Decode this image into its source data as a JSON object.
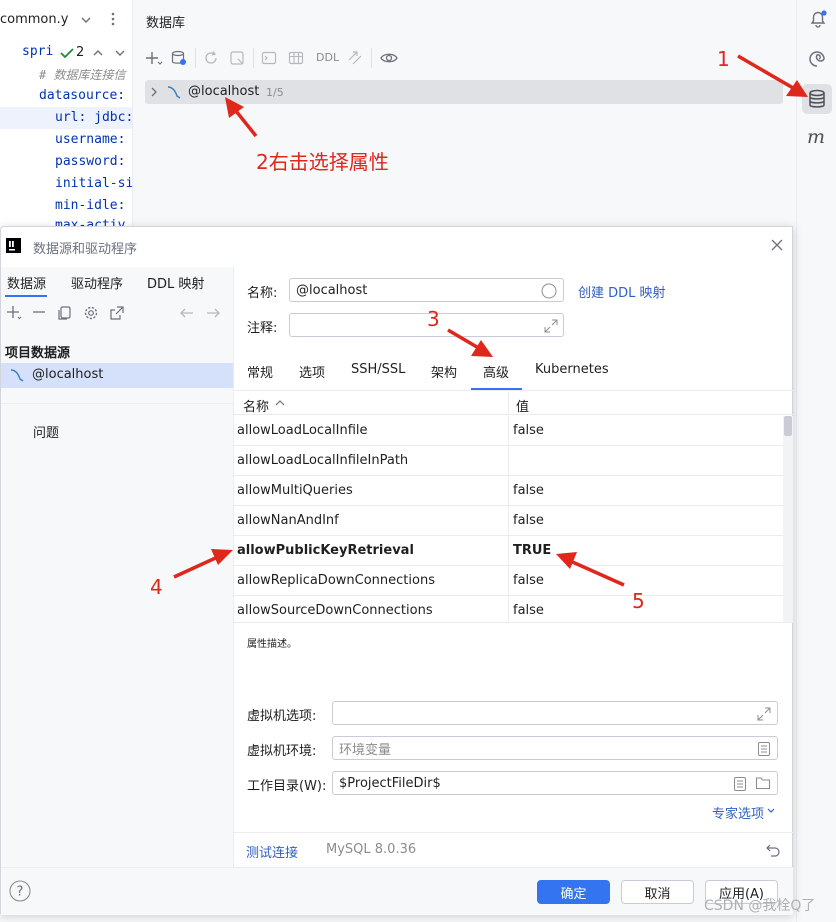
{
  "editor": {
    "tab_name": "common.y",
    "code_lines": [
      {
        "text": "spri",
        "color": "#0033b3"
      },
      {
        "text": "# 数据库连接信",
        "color": "#8c8c8c"
      },
      {
        "text": "datasource:",
        "color": "#0033b3"
      },
      {
        "text": "url: jdbc:",
        "color": "#0033b3"
      },
      {
        "text": "username:",
        "color": "#0033b3"
      },
      {
        "text": "password:",
        "color": "#0033b3"
      },
      {
        "text": "initial-si",
        "color": "#0033b3"
      },
      {
        "text": "min-idle:",
        "color": "#0033b3"
      },
      {
        "text": "max-activ",
        "color": "#0033b3"
      }
    ],
    "inspection_count": "2"
  },
  "db_pane": {
    "title": "数据库",
    "ddl_label": "DDL",
    "tree_item": "@localhost",
    "tree_count": "1/5"
  },
  "dialog": {
    "title": "数据源和驱动程序",
    "left_tabs": [
      "数据源",
      "驱动程序",
      "DDL 映射"
    ],
    "section_title": "项目数据源",
    "datasource_item": "@localhost",
    "problems_label": "问题",
    "name_label": "名称:",
    "name_value": "@localhost",
    "create_ddl_link": "创建 DDL 映射",
    "comment_label": "注释:",
    "tabs": [
      "常规",
      "选项",
      "SSH/SSL",
      "架构",
      "高级",
      "Kubernetes"
    ],
    "active_tab": "高级",
    "table_header_name": "名称",
    "table_header_value": "值",
    "properties": [
      {
        "name": "allowLoadLocalInfile",
        "value": "false",
        "bold": false
      },
      {
        "name": "allowLoadLocalInfileInPath",
        "value": "",
        "bold": false
      },
      {
        "name": "allowMultiQueries",
        "value": "false",
        "bold": false
      },
      {
        "name": "allowNanAndInf",
        "value": "false",
        "bold": false
      },
      {
        "name": "allowPublicKeyRetrieval",
        "value": "TRUE",
        "bold": true
      },
      {
        "name": "allowReplicaDownConnections",
        "value": "false",
        "bold": false
      },
      {
        "name": "allowSourceDownConnections",
        "value": "false",
        "bold": false
      }
    ],
    "property_description": "属性描述。",
    "vm_options_label": "虚拟机选项:",
    "vm_env_label": "虚拟机环境:",
    "vm_env_placeholder": "环境变量",
    "workdir_label": "工作目录(W):",
    "workdir_value": "$ProjectFileDir$",
    "expert_options": "专家选项",
    "test_connection": "测试连接",
    "driver_version": "MySQL 8.0.36",
    "ok_label": "确定",
    "cancel_label": "取消",
    "apply_label": "应用(A)"
  },
  "annotations": {
    "a1": "1",
    "a2": "2右击选择属性",
    "a3": "3",
    "a4": "4",
    "a5": "5",
    "color": "#e0271c"
  },
  "watermark": "CSDN @我栓Q了"
}
